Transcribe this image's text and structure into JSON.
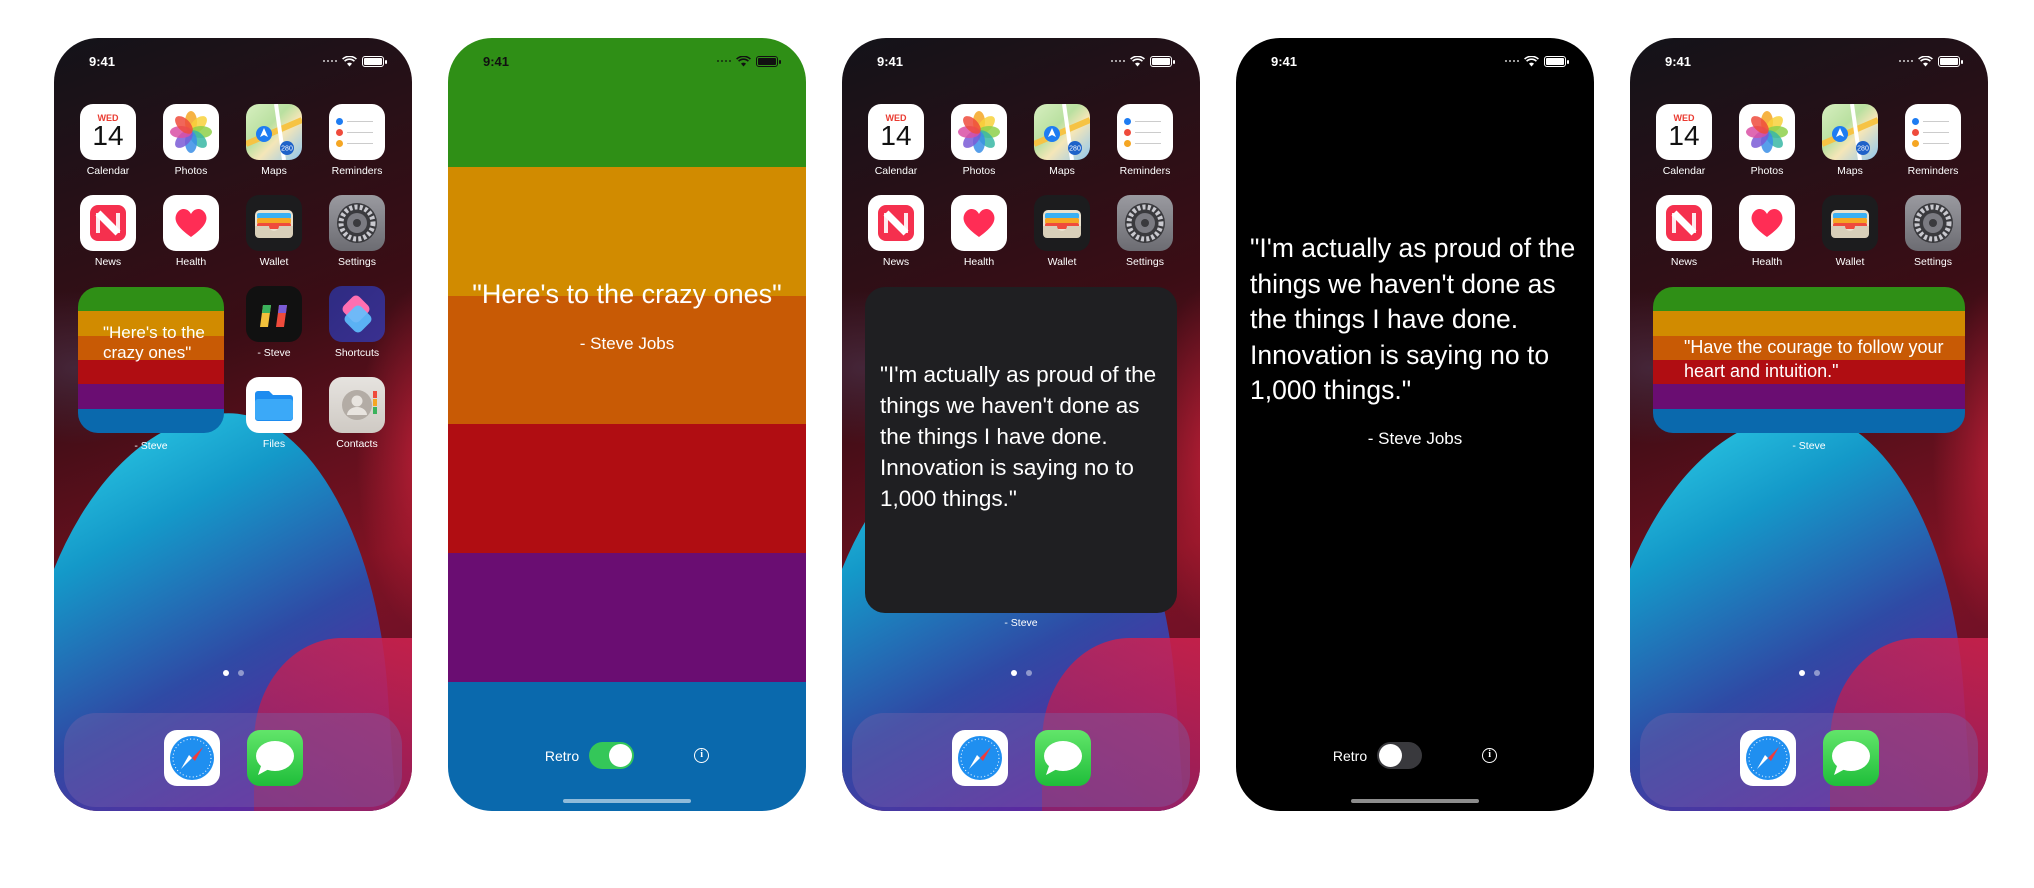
{
  "status": {
    "time": "9:41"
  },
  "home": {
    "row1": [
      {
        "label": "Calendar",
        "icon": "calendar-icon",
        "cal_day": "WED",
        "cal_num": "14"
      },
      {
        "label": "Photos",
        "icon": "photos-icon"
      },
      {
        "label": "Maps",
        "icon": "maps-icon",
        "badge": "280"
      },
      {
        "label": "Reminders",
        "icon": "reminders-icon"
      }
    ],
    "row2": [
      {
        "label": "News",
        "icon": "news-icon"
      },
      {
        "label": "Health",
        "icon": "health-icon"
      },
      {
        "label": "Wallet",
        "icon": "wallet-icon"
      },
      {
        "label": "Settings",
        "icon": "settings-icon"
      }
    ],
    "phone1_extra": [
      {
        "label": "- Steve",
        "icon": "quote-app-icon"
      },
      {
        "label": "Shortcuts",
        "icon": "shortcuts-icon"
      },
      {
        "label": "Files",
        "icon": "files-icon"
      },
      {
        "label": "Contacts",
        "icon": "contacts-icon"
      }
    ],
    "dock": [
      {
        "label": "Safari",
        "icon": "safari-icon"
      },
      {
        "label": "Messages",
        "icon": "messages-icon"
      }
    ]
  },
  "retro_colors": [
    "#2f8f16",
    "#d18b00",
    "#c85a05",
    "#b00d12",
    "#6a0d72",
    "#0a69ad"
  ],
  "phone1": {
    "widget_text": "\"Here's to the crazy ones\"",
    "widget_caption": "- Steve"
  },
  "phone2": {
    "quote": "\"Here's to the crazy ones\"",
    "author": "- Steve Jobs",
    "toggle_label": "Retro",
    "toggle_on": true,
    "toggle_color": "#34c759"
  },
  "phone3": {
    "widget_text": "\"I'm actually as proud of the things we haven't done as the things I have done. Innovation is saying no to 1,000 things.\"",
    "widget_caption": "- Steve"
  },
  "phone4": {
    "quote": "\"I'm actually as proud of the things we haven't done as the things I have done. Innovation is saying no to 1,000 things.\"",
    "author": "- Steve Jobs",
    "toggle_label": "Retro",
    "toggle_on": false
  },
  "phone5": {
    "widget_text": "\"Have the courage to follow your heart and intuition.\"",
    "widget_caption": "- Steve"
  }
}
